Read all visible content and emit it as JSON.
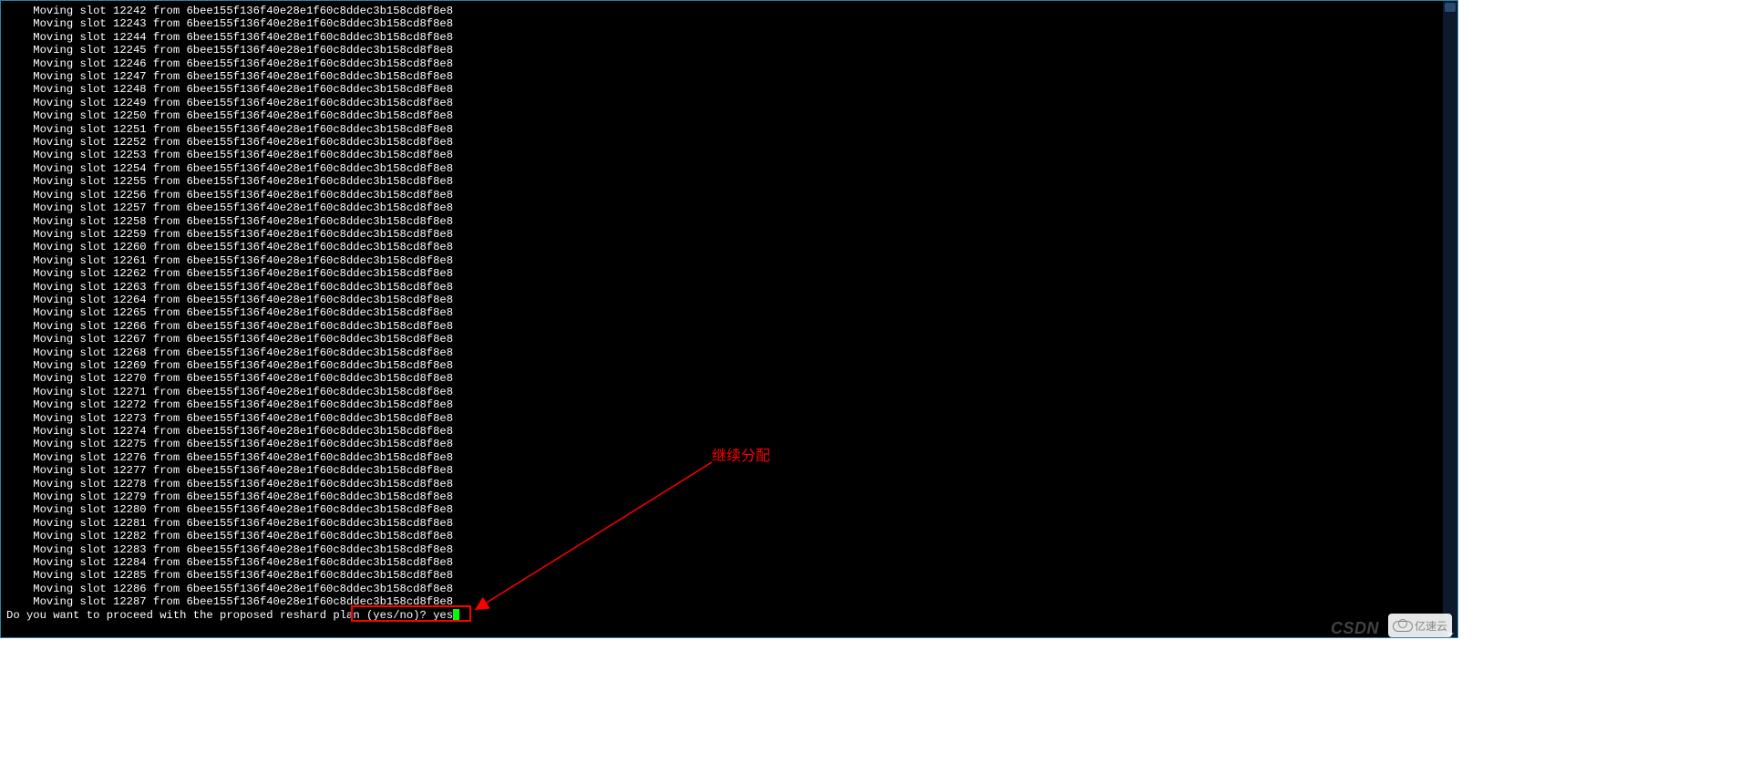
{
  "terminal": {
    "line_prefix": "    Moving slot ",
    "line_mid": " from ",
    "src_node": "6bee155f136f40e28e1f60c8ddec3b158cd8f8e8",
    "slot_start": 12242,
    "slot_end": 12287,
    "prompt_prefix": "Do you want to proceed with the proposed reshard ",
    "prompt_highlight": "plan (yes/no)? yes"
  },
  "annotation": {
    "label": "继续分配"
  },
  "watermarks": {
    "csdn": "CSDN",
    "yisu": "亿速云"
  },
  "colors": {
    "accent": "#ff0000",
    "cursor": "#00ff00",
    "terminal_border": "#2a82a5"
  }
}
